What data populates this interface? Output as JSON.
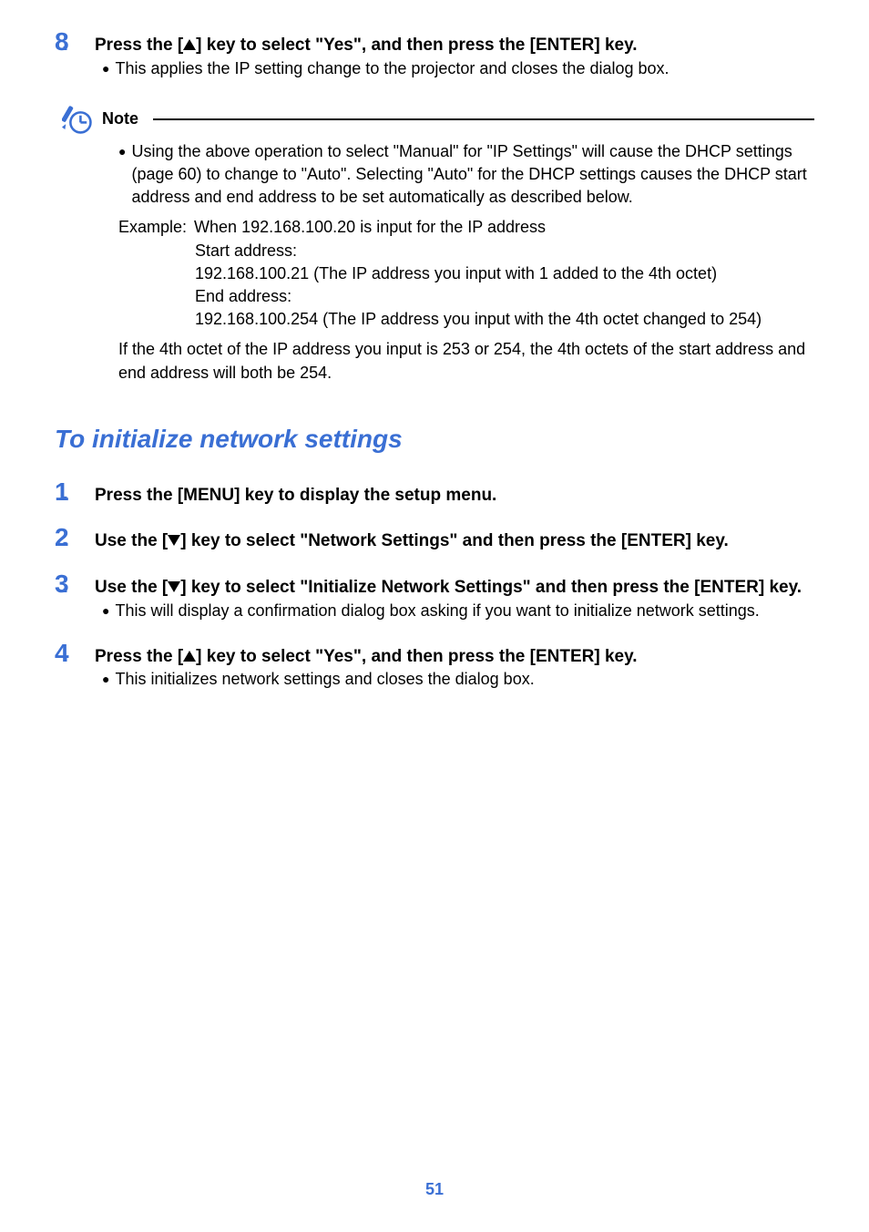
{
  "step8": {
    "num": "8",
    "title_a": "Press the [",
    "title_b": "] key to select \"Yes\", and then press the [ENTER] key.",
    "bullet1": "This applies the IP setting change to the projector and closes the dialog box."
  },
  "note": {
    "label": "Note",
    "bullet": "Using the above operation to select \"Manual\" for \"IP Settings\" will cause the DHCP settings (page 60) to change to \"Auto\". Selecting \"Auto\" for the DHCP settings causes the DHCP start address and end address to be set automatically as described below.",
    "example_label": "Example:",
    "example_when": "When 192.168.100.20 is input for the IP address",
    "start_label": "Start address:",
    "start_value": "192.168.100.21 (The IP address you input with 1 added to the 4th octet)",
    "end_label": "End address:",
    "end_value": "192.168.100.254 (The IP address you input with the 4th octet changed to 254)",
    "tail": "If the 4th octet of the IP address you input is 253 or 254, the 4th octets of the start address and end address will both be 254."
  },
  "section_title": "To initialize network settings",
  "s1": {
    "num": "1",
    "title": "Press the [MENU] key to display the setup menu."
  },
  "s2": {
    "num": "2",
    "title_a": "Use the [",
    "title_b": "] key to select \"Network Settings\" and then press the [ENTER] key."
  },
  "s3": {
    "num": "3",
    "title_a": "Use the [",
    "title_b": "] key to select \"Initialize Network Settings\" and then press the [ENTER] key.",
    "bullet1": "This will display a confirmation dialog box asking if you want to initialize network settings."
  },
  "s4": {
    "num": "4",
    "title_a": "Press the [",
    "title_b": "] key to select \"Yes\", and then press the [ENTER] key.",
    "bullet1": "This initializes network settings and closes the dialog box."
  },
  "page_number": "51"
}
